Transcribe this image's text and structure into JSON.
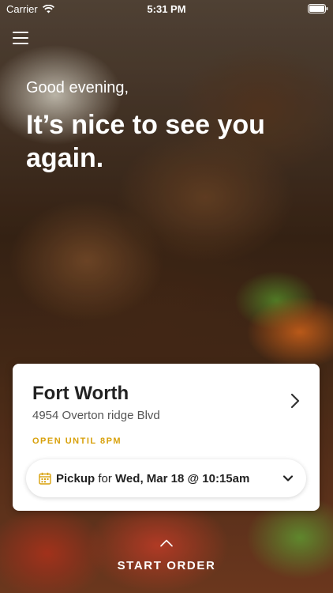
{
  "status_bar": {
    "carrier": "Carrier",
    "time": "5:31 PM"
  },
  "greeting": "Good evening,",
  "headline": "It’s nice to see you again.",
  "store": {
    "name": "Fort Worth",
    "address": "4954 Overton ridge Blvd",
    "hours": "OPEN UNTIL 8PM"
  },
  "pickup": {
    "mode": "Pickup",
    "connector": "for",
    "datetime": "Wed, Mar 18 @ 10:15am"
  },
  "cta": {
    "label": "START ORDER"
  },
  "colors": {
    "accent": "#d8a10c",
    "card": "#ffffff",
    "text_dark": "#222222"
  },
  "icons": [
    "wifi-icon",
    "battery-icon",
    "menu-icon",
    "chevron-right-icon",
    "calendar-icon",
    "chevron-down-icon",
    "chevron-up-icon"
  ]
}
